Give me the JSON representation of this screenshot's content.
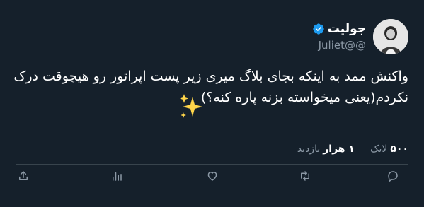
{
  "tweet": {
    "author": {
      "display_name": "جولیت",
      "handle": "Juliet@@",
      "verified": true
    },
    "text": "واکنش ممد به اینکه بجای بلاگ میری زیر پست اپراتور رو هیچوقت درک نکردم(یعنی میخواسته بزنه پاره کنه؟)",
    "stats": {
      "likes_count": "۵۰۰",
      "likes_label": "لایک",
      "views_count": "۱ هزار",
      "views_label": "بازدید"
    },
    "actions": [
      "reply-icon",
      "retweet-icon",
      "like-icon",
      "views-icon",
      "share-icon"
    ]
  },
  "colors": {
    "background": "#15202b",
    "text_primary": "#ffffff",
    "text_secondary": "#8b98a5",
    "verified_blue": "#1d9bf0",
    "divider": "#38444d",
    "sparkle": "#ffd54a"
  }
}
